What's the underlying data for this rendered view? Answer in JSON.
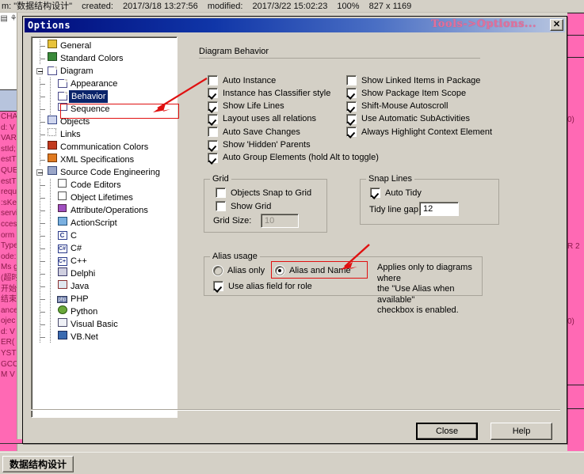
{
  "background": {
    "statusline": {
      "project": "m: \"数据结构设计\"",
      "created_label": "created:",
      "created_value": "2017/3/18 13:27:56",
      "modified_label": "modified:",
      "modified_value": "2017/3/22 15:02:23",
      "zoom": "100%",
      "size": "827 x 1169"
    },
    "left_fragments": [
      "CHA",
      "d: V",
      "VAR",
      "stId;",
      "estT",
      "QUE",
      "estT",
      "requ",
      ":sKe",
      "servi",
      "cces",
      "orm",
      "Type",
      "ode:",
      "Ms g",
      "(超时)",
      "开始时",
      "结束时",
      "ance",
      "ojec",
      "d: V",
      "ER(",
      "YSTE",
      "GCO",
      "M  V"
    ],
    "right_fragments": [
      "0)",
      "R 2",
      "0)"
    ],
    "taskbar_button": "数据结构设计"
  },
  "dialog": {
    "title": "Options",
    "annotation": "Tools->Options...",
    "close_icon": "✕",
    "tree": [
      {
        "label": "General",
        "level": 0,
        "icon": "general-icon",
        "expander": "none"
      },
      {
        "label": "Standard Colors",
        "level": 0,
        "icon": "palette-icon",
        "expander": "none"
      },
      {
        "label": "Diagram",
        "level": 0,
        "icon": "page-icon",
        "expander": "minus"
      },
      {
        "label": "Appearance",
        "level": 1,
        "icon": "page-icon",
        "expander": "none"
      },
      {
        "label": "Behavior",
        "level": 1,
        "icon": "page-icon",
        "expander": "none",
        "selected": true
      },
      {
        "label": "Sequence",
        "level": 1,
        "icon": "sequence-icon",
        "expander": "none"
      },
      {
        "label": "Objects",
        "level": 0,
        "icon": "objects-icon",
        "expander": "none"
      },
      {
        "label": "Links",
        "level": 0,
        "icon": "links-icon",
        "expander": "none"
      },
      {
        "label": "Communication Colors",
        "level": 0,
        "icon": "comm-colors-icon",
        "expander": "none"
      },
      {
        "label": "XML Specifications",
        "level": 0,
        "icon": "xml-icon",
        "expander": "none"
      },
      {
        "label": "Source Code Engineering",
        "level": 0,
        "icon": "source-code-icon",
        "expander": "minus"
      },
      {
        "label": "Code Editors",
        "level": 1,
        "icon": "editor-icon",
        "expander": "none"
      },
      {
        "label": "Object Lifetimes",
        "level": 1,
        "icon": "editor-icon",
        "expander": "none"
      },
      {
        "label": "Attribute/Operations",
        "level": 1,
        "icon": "attribute-icon",
        "expander": "none"
      },
      {
        "label": "ActionScript",
        "level": 1,
        "icon": "actionscript-icon",
        "expander": "none"
      },
      {
        "label": "C",
        "level": 1,
        "icon": "c-icon",
        "expander": "none"
      },
      {
        "label": "C#",
        "level": 1,
        "icon": "csharp-icon",
        "expander": "none"
      },
      {
        "label": "C++",
        "level": 1,
        "icon": "cpp-icon",
        "expander": "none"
      },
      {
        "label": "Delphi",
        "level": 1,
        "icon": "delphi-icon",
        "expander": "none"
      },
      {
        "label": "Java",
        "level": 1,
        "icon": "java-icon",
        "expander": "none"
      },
      {
        "label": "PHP",
        "level": 1,
        "icon": "php-icon",
        "expander": "none"
      },
      {
        "label": "Python",
        "level": 1,
        "icon": "python-icon",
        "expander": "none"
      },
      {
        "label": "Visual Basic",
        "level": 1,
        "icon": "vb-icon",
        "expander": "none"
      },
      {
        "label": "VB.Net",
        "level": 1,
        "icon": "vbnet-icon",
        "expander": "none"
      }
    ],
    "panel": {
      "section_title": "Diagram Behavior",
      "checkboxes_left": [
        {
          "label": "Auto Instance",
          "checked": false
        },
        {
          "label": "Instance has Classifier style",
          "checked": true
        },
        {
          "label": "Show Life Lines",
          "checked": true
        },
        {
          "label": "Layout uses all relations",
          "checked": true
        },
        {
          "label": "Auto Save Changes",
          "checked": false
        },
        {
          "label": "Show 'Hidden' Parents",
          "checked": true
        },
        {
          "label": "Auto Group Elements (hold Alt to toggle)",
          "checked": true
        }
      ],
      "checkboxes_right": [
        {
          "label": "Show Linked Items in Package",
          "checked": false
        },
        {
          "label": "Show Package Item Scope",
          "checked": true
        },
        {
          "label": "Shift-Mouse Autoscroll",
          "checked": true
        },
        {
          "label": "Use Automatic SubActivities",
          "checked": true
        },
        {
          "label": "Always Highlight Context Element",
          "checked": true
        }
      ],
      "grid": {
        "title": "Grid",
        "snap_label": "Objects Snap to Grid",
        "snap_checked": false,
        "show_label": "Show Grid",
        "show_checked": false,
        "size_label": "Grid Size:",
        "size_value": "10",
        "size_disabled": true
      },
      "snap_lines": {
        "title": "Snap Lines",
        "auto_tidy_label": "Auto Tidy",
        "auto_tidy_checked": true,
        "gap_label": "Tidy line gap:",
        "gap_value": "12"
      },
      "alias": {
        "title": "Alias usage",
        "option_alias_only": "Alias only",
        "option_alias_and_name": "Alias and Name",
        "selected": "Alias and Name",
        "use_alias_field_label": "Use alias field for role",
        "use_alias_field_checked": true,
        "help_line1": "Applies only to diagrams where",
        "help_line2": "the \"Use Alias when available\"",
        "help_line3": "checkbox is enabled."
      }
    },
    "buttons": {
      "close": "Close",
      "help": "Help"
    }
  },
  "colors": {
    "dialog_face": "#d4d0c6",
    "title_blue": "#000b7a",
    "annotation_pink": "#e0719b",
    "annotation_red": "#e01010",
    "selection_blue": "#0a246a",
    "background_pink": "#ff69b4"
  }
}
